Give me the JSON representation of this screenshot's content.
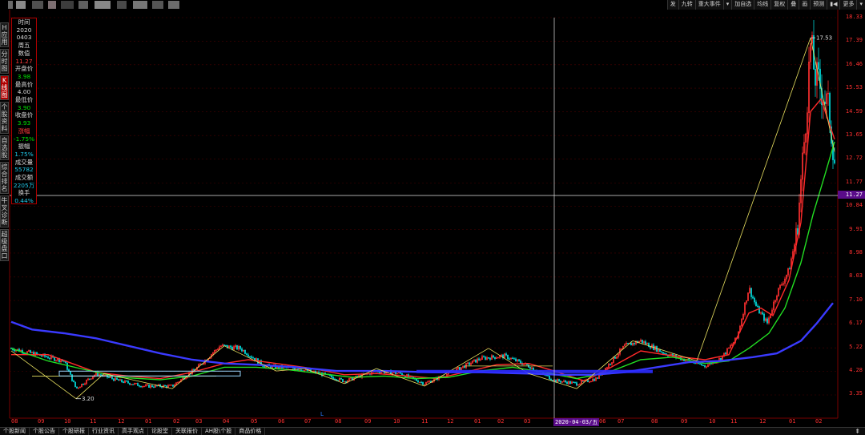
{
  "toolbar": {
    "buttons": [
      "发",
      "九转",
      "重大事件",
      "▾",
      "加自选",
      "均线",
      "复权",
      "叠",
      "画",
      "预测",
      "▮◀",
      "更多",
      "▾"
    ]
  },
  "left_tabs": [
    {
      "label": "H\n应\n用",
      "active": false
    },
    {
      "label": "分\n时\n图",
      "active": false
    },
    {
      "label": "K\n线\n图",
      "active": true
    },
    {
      "label": "个\n股\n资\n料",
      "active": false
    },
    {
      "label": "自\n选\n股",
      "active": false
    },
    {
      "label": "综\n合\n排\n名",
      "active": false
    },
    {
      "label": "牛\n叉\n诊\n断",
      "active": false
    },
    {
      "label": "超\n级\n盘\n口",
      "active": false
    }
  ],
  "info_panel": {
    "time_label": "时间",
    "year": "2020",
    "date": "0403",
    "weekday": "周五",
    "value_label": "数值",
    "value": "11.27",
    "open_label": "开盘价",
    "open": "3.98",
    "high_label": "最高价",
    "high": "4.00",
    "low_label": "最低价",
    "low": "3.90",
    "close_label": "收盘价",
    "close": "3.93",
    "change_label": "涨幅",
    "change": "-1.75%",
    "amplitude_label": "振幅",
    "amplitude": "1.75%",
    "volume_label": "成交量",
    "volume": "55782",
    "turnover_label": "成交额",
    "turnover": "2205万",
    "turnover_rate_label": "换手",
    "turnover_rate": "0.44%"
  },
  "price_scale": [
    "18.33",
    "17.39",
    "16.46",
    "15.53",
    "14.59",
    "13.65",
    "12.72",
    "11.77",
    "10.84",
    "9.91",
    "8.98",
    "8.03",
    "7.10",
    "6.17",
    "5.22",
    "4.28",
    "3.35"
  ],
  "crosshair_value": "11.27",
  "time_axis": [
    "08",
    "09",
    "10",
    "11",
    "12",
    "01",
    "02",
    "03",
    "04",
    "05",
    "06",
    "07",
    "08",
    "09",
    "10",
    "11",
    "12",
    "01",
    "02",
    "03",
    "05",
    "06",
    "07",
    "08",
    "09",
    "10",
    "11",
    "12",
    "01",
    "02"
  ],
  "crosshair_date": "2020-04-03/五",
  "annotations": {
    "high_marker": "17.53",
    "low_marker": "3.20"
  },
  "bottom_tabs": [
    "个股新闻",
    "个股公告",
    "个股研报",
    "行业资讯",
    "高手观点",
    "论股堂",
    "关联报价",
    "AH股\\个股",
    "商品价格"
  ],
  "scroll_icon": "⇞",
  "colors": {
    "up": "#ff3030",
    "down": "#00d0d0",
    "ma_short": "#ff2a2a",
    "ma_mid": "#22dd22",
    "ma_long": "#3a3aff",
    "trend": "#e8e060",
    "crosshair_label": "#5a0c8a"
  }
}
